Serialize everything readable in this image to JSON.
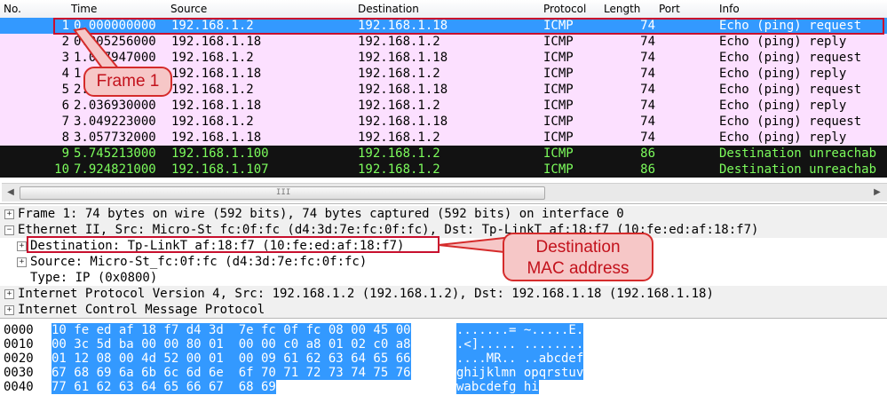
{
  "columns": {
    "no": "No.",
    "time": "Time",
    "source": "Source",
    "destination": "Destination",
    "protocol": "Protocol",
    "length": "Length",
    "port": "Port",
    "info": "Info"
  },
  "packets": [
    {
      "no": "1",
      "time": "0.000000000",
      "source": "192.168.1.2",
      "destination": "192.168.1.18",
      "protocol": "ICMP",
      "length": "74",
      "info": "Echo (ping) request"
    },
    {
      "no": "2",
      "time": "0.005256000",
      "source": "192.168.1.18",
      "destination": "192.168.1.2",
      "protocol": "ICMP",
      "length": "74",
      "info": "Echo (ping) reply"
    },
    {
      "no": "3",
      "time": "1.017947000",
      "source": "192.168.1.2",
      "destination": "192.168.1.18",
      "protocol": "ICMP",
      "length": "74",
      "info": "Echo (ping) request"
    },
    {
      "no": "4",
      "time": "1.023316000",
      "source": "192.168.1.18",
      "destination": "192.168.1.2",
      "protocol": "ICMP",
      "length": "74",
      "info": "Echo (ping) reply"
    },
    {
      "no": "5",
      "time": "2.031220000",
      "source": "192.168.1.2",
      "destination": "192.168.1.18",
      "protocol": "ICMP",
      "length": "74",
      "info": "Echo (ping) request"
    },
    {
      "no": "6",
      "time": "2.036930000",
      "source": "192.168.1.18",
      "destination": "192.168.1.2",
      "protocol": "ICMP",
      "length": "74",
      "info": "Echo (ping) reply"
    },
    {
      "no": "7",
      "time": "3.049223000",
      "source": "192.168.1.2",
      "destination": "192.168.1.18",
      "protocol": "ICMP",
      "length": "74",
      "info": "Echo (ping) request"
    },
    {
      "no": "8",
      "time": "3.057732000",
      "source": "192.168.1.18",
      "destination": "192.168.1.2",
      "protocol": "ICMP",
      "length": "74",
      "info": "Echo (ping) reply"
    },
    {
      "no": "9",
      "time": "5.745213000",
      "source": "192.168.1.100",
      "destination": "192.168.1.2",
      "protocol": "ICMP",
      "length": "86",
      "info": "Destination unreachab"
    },
    {
      "no": "10",
      "time": "7.924821000",
      "source": "192.168.1.107",
      "destination": "192.168.1.2",
      "protocol": "ICMP",
      "length": "86",
      "info": "Destination unreachab"
    }
  ],
  "row_colors": {
    "selected_bg": "#3399ff",
    "icmp_bg": "#fce0ff",
    "unreachable_bg": "#121212",
    "unreachable_fg": "#7cfc5c"
  },
  "detail": {
    "frame": "Frame 1: 74 bytes on wire (592 bits), 74 bytes captured (592 bits) on interface 0",
    "ethernet": "Ethernet II, Src: Micro-St_fc:0f:fc (d4:3d:7e:fc:0f:fc), Dst: Tp-LinkT_af:18:f7 (10:fe:ed:af:18:f7)",
    "eth_dst": "Destination: Tp-LinkT_af:18:f7 (10:fe:ed:af:18:f7)",
    "eth_src": "Source: Micro-St_fc:0f:fc (d4:3d:7e:fc:0f:fc)",
    "eth_type": "Type: IP (0x0800)",
    "ip": "Internet Protocol Version 4, Src: 192.168.1.2 (192.168.1.2), Dst: 192.168.1.18 (192.168.1.18)",
    "icmp": "Internet Control Message Protocol"
  },
  "bytes": [
    {
      "offset": "0000",
      "hex": "10 fe ed af 18 f7 d4 3d  7e fc 0f fc 08 00 45 00",
      "ascii": ".......= ~.....E."
    },
    {
      "offset": "0010",
      "hex": "00 3c 5d ba 00 00 80 01  00 00 c0 a8 01 02 c0 a8",
      "ascii": ".<]..... ........"
    },
    {
      "offset": "0020",
      "hex": "01 12 08 00 4d 52 00 01  00 09 61 62 63 64 65 66",
      "ascii": "....MR.. ..abcdef"
    },
    {
      "offset": "0030",
      "hex": "67 68 69 6a 6b 6c 6d 6e  6f 70 71 72 73 74 75 76",
      "ascii": "ghijklmn opqrstuv"
    },
    {
      "offset": "0040",
      "hex": "77 61 62 63 64 65 66 67  68 69",
      "ascii": "wabcdefg hi"
    }
  ],
  "callouts": {
    "frame": "Frame 1",
    "mac_line1": "Destination",
    "mac_line2": "MAC address"
  },
  "scrollbar": {
    "grip": "III"
  }
}
